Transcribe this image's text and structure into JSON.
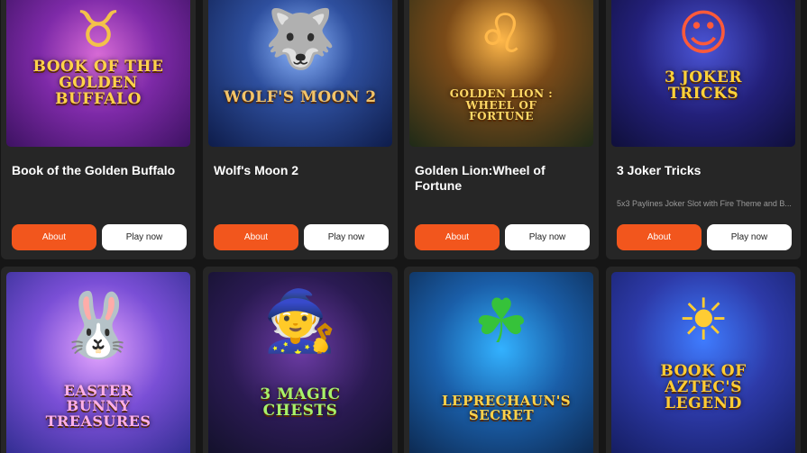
{
  "buttons": {
    "about_label": "About",
    "play_label": "Play now"
  },
  "games": [
    {
      "name": "Book of the Golden Buffalo",
      "description": "",
      "art_title": "BOOK OF THE GOLDEN BUFFALO",
      "art_icon": "buffalo-icon",
      "art_glyph": "♉",
      "title_color": "#ffd24a"
    },
    {
      "name": "Wolf's Moon 2",
      "description": "",
      "art_title": "WOLF'S MOON 2",
      "art_icon": "wolf-icon",
      "art_glyph": "🐺",
      "title_color": "#f2c46a"
    },
    {
      "name": "Golden Lion:Wheel of Fortune",
      "description": "",
      "art_title": "GOLDEN LION : WHEEL OF FORTUNE",
      "art_icon": "lion-icon",
      "art_glyph": "♌",
      "title_color": "#ffd966"
    },
    {
      "name": "3 Joker Tricks",
      "description": "5x3 Paylines Joker Slot with Fire Theme and B...",
      "art_title": "3 JOKER TRICKS",
      "art_icon": "joker-icon",
      "art_glyph": "☺",
      "title_color": "#ffd23a"
    },
    {
      "art_title": "EASTER BUNNY TREASURES",
      "art_icon": "bunny-icon",
      "art_glyph": "🐰",
      "title_color": "#ffb0e8"
    },
    {
      "art_title": "3 MAGIC CHESTS",
      "art_icon": "chest-icon",
      "art_glyph": "🧙",
      "title_color": "#a8f26a"
    },
    {
      "art_title": "LEPRECHAUN'S SECRET",
      "art_icon": "leprechaun-icon",
      "art_glyph": "☘",
      "title_color": "#ffd24a"
    },
    {
      "art_title": "BOOK OF AZTEC'S LEGEND",
      "art_icon": "aztec-icon",
      "art_glyph": "☀",
      "title_color": "#ffcc33"
    }
  ]
}
